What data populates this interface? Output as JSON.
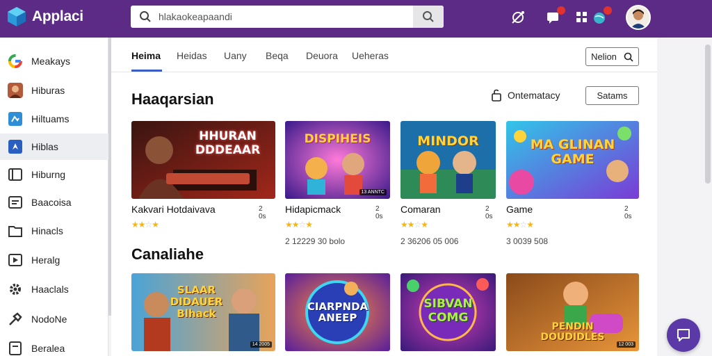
{
  "app": {
    "title": "Applaci"
  },
  "search": {
    "value": "hlakaokeapaandi"
  },
  "sidebar": {
    "items": [
      {
        "label": "Meakays",
        "icon": "google-icon"
      },
      {
        "label": "Hiburas",
        "icon": "person-icon"
      },
      {
        "label": "Hiltuams",
        "icon": "grid-icon"
      },
      {
        "label": "Hiblas",
        "icon": "compass-icon"
      },
      {
        "label": "Hiburng",
        "icon": "store-icon"
      },
      {
        "label": "Baacoisa",
        "icon": "list-icon"
      },
      {
        "label": "Hinacls",
        "icon": "folder-icon"
      },
      {
        "label": "Heralg",
        "icon": "play-icon"
      },
      {
        "label": "Haaclals",
        "icon": "gear-icon"
      },
      {
        "label": "NodoNe",
        "icon": "tool-icon"
      },
      {
        "label": "Beralea",
        "icon": "doc-icon"
      }
    ]
  },
  "tabs": [
    "Heima",
    "Heidas",
    "Uany",
    "Beqa",
    "Deuora",
    "Ueheras"
  ],
  "tab_button": "Nelion",
  "section1": {
    "title": "Haaqarsian",
    "sort_label": "Ontematacy",
    "button": "Satams",
    "cards": [
      {
        "title": "Kakvari Hotdaivava",
        "size": "2 0s",
        "rating": 3,
        "meta": "",
        "thumb_text": "HHURAN DDDEAAR",
        "tag": ""
      },
      {
        "title": "Hidapicmack",
        "size": "2 0s",
        "rating": 3,
        "meta": "2 12229 30 bolo",
        "thumb_text": "DISPIHEIS",
        "tag": "13 ANNTC"
      },
      {
        "title": "Comaran",
        "size": "2 0s",
        "rating": 3,
        "meta": "2 36206 05 006",
        "thumb_text": "MINDOR",
        "tag": ""
      },
      {
        "title": "Game",
        "size": "2 0s",
        "rating": 3,
        "meta": "3 0039 508",
        "thumb_text": "MA GLINAN GAME",
        "tag": ""
      }
    ]
  },
  "section2": {
    "title": "Canaliahe",
    "cards": [
      {
        "thumb_text": "SLAAR DIDAUER Blhack",
        "tag": "14 2005"
      },
      {
        "thumb_text": "CIARPNDA ANEEP",
        "tag": ""
      },
      {
        "thumb_text": "SIBVAN COMG",
        "tag": ""
      },
      {
        "thumb_text": "PENDIN DOUDIDLES",
        "tag": "12 003"
      }
    ]
  },
  "colors": {
    "header": "#5b2b86",
    "accent": "#3c5ec4",
    "fab": "#5b3aa8",
    "star": "#f2b51c"
  }
}
